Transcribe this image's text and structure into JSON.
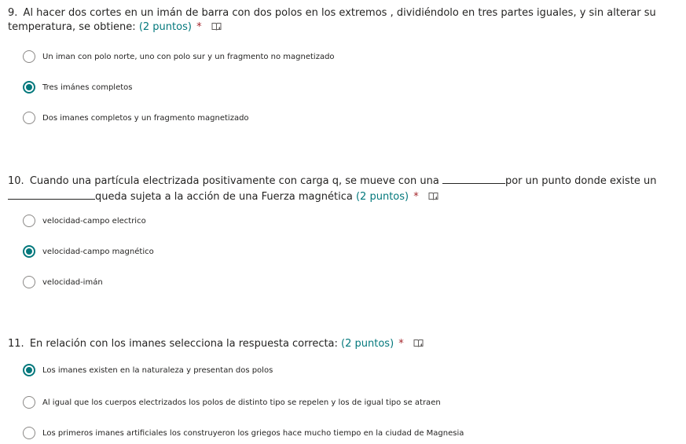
{
  "questions": [
    {
      "number": "9.",
      "text": "Al hacer dos cortes en un imán de barra con dos polos en los extremos , dividiéndolo en tres partes iguales, y sin alterar su temperatura, se obtiene:",
      "points": "(2 puntos)",
      "required_mark": "*",
      "reader_icon": "immersive-reader-icon",
      "options": [
        {
          "label": "Un iman con polo norte, uno con polo sur y un fragmento no magnetizado",
          "selected": false
        },
        {
          "label": "Tres imánes completos",
          "selected": true
        },
        {
          "label": "Dos imanes completos y un fragmento magnetizado",
          "selected": false
        }
      ]
    },
    {
      "number": "10.",
      "text_part1": "Cuando una partícula electrizada positivamente con carga q, se mueve con una",
      "text_part2": "por un punto donde existe un",
      "text_part3": "queda sujeta a la acción de una Fuerza magnética",
      "points": "(2 puntos)",
      "required_mark": "*",
      "reader_icon": "immersive-reader-icon",
      "options": [
        {
          "label": "velocidad-campo electrico",
          "selected": false
        },
        {
          "label": "velocidad-campo magnético",
          "selected": true
        },
        {
          "label": "velocidad-imán",
          "selected": false
        }
      ]
    },
    {
      "number": "11.",
      "text": "En relación con los imanes selecciona la respuesta correcta:",
      "points": "(2 puntos)",
      "required_mark": "*",
      "reader_icon": "immersive-reader-icon",
      "options": [
        {
          "label": "Los imanes existen en la naturaleza y presentan dos polos",
          "selected": true
        },
        {
          "label": "Al igual que los cuerpos electrizados los polos de distinto tipo se repelen y los de igual tipo se atraen",
          "selected": false
        },
        {
          "label": "Los primeros imanes artificiales los construyeron los griegos hace mucho tiempo en la ciudad de Magnesia",
          "selected": false
        }
      ]
    }
  ],
  "colors": {
    "accent": "#03787c",
    "required": "#a4262c",
    "text": "#252423",
    "radio_border": "#8a8886"
  }
}
